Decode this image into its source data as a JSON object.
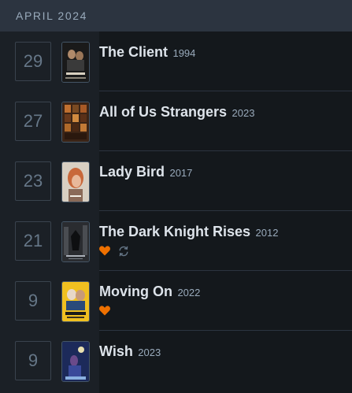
{
  "month": {
    "title": "APRIL 2024"
  },
  "entries": [
    {
      "day": "29",
      "title": "The Client",
      "year": "1994",
      "liked": false,
      "rewatch": false,
      "poster": "poster-the-client"
    },
    {
      "day": "27",
      "title": "All of Us Strangers",
      "year": "2023",
      "liked": false,
      "rewatch": false,
      "poster": "poster-all-of-us-strangers"
    },
    {
      "day": "23",
      "title": "Lady Bird",
      "year": "2017",
      "liked": false,
      "rewatch": false,
      "poster": "poster-lady-bird"
    },
    {
      "day": "21",
      "title": "The Dark Knight Rises",
      "year": "2012",
      "liked": true,
      "rewatch": true,
      "poster": "poster-the-dark-knight-rises"
    },
    {
      "day": "9",
      "title": "Moving On",
      "year": "2022",
      "liked": true,
      "rewatch": false,
      "poster": "poster-moving-on"
    },
    {
      "day": "9",
      "title": "Wish",
      "year": "2023",
      "liked": false,
      "rewatch": false,
      "poster": "poster-wish"
    }
  ],
  "colors": {
    "background": "#14181c",
    "header": "#2c3440",
    "heart": "#ee7000",
    "rewatch": "#678"
  }
}
